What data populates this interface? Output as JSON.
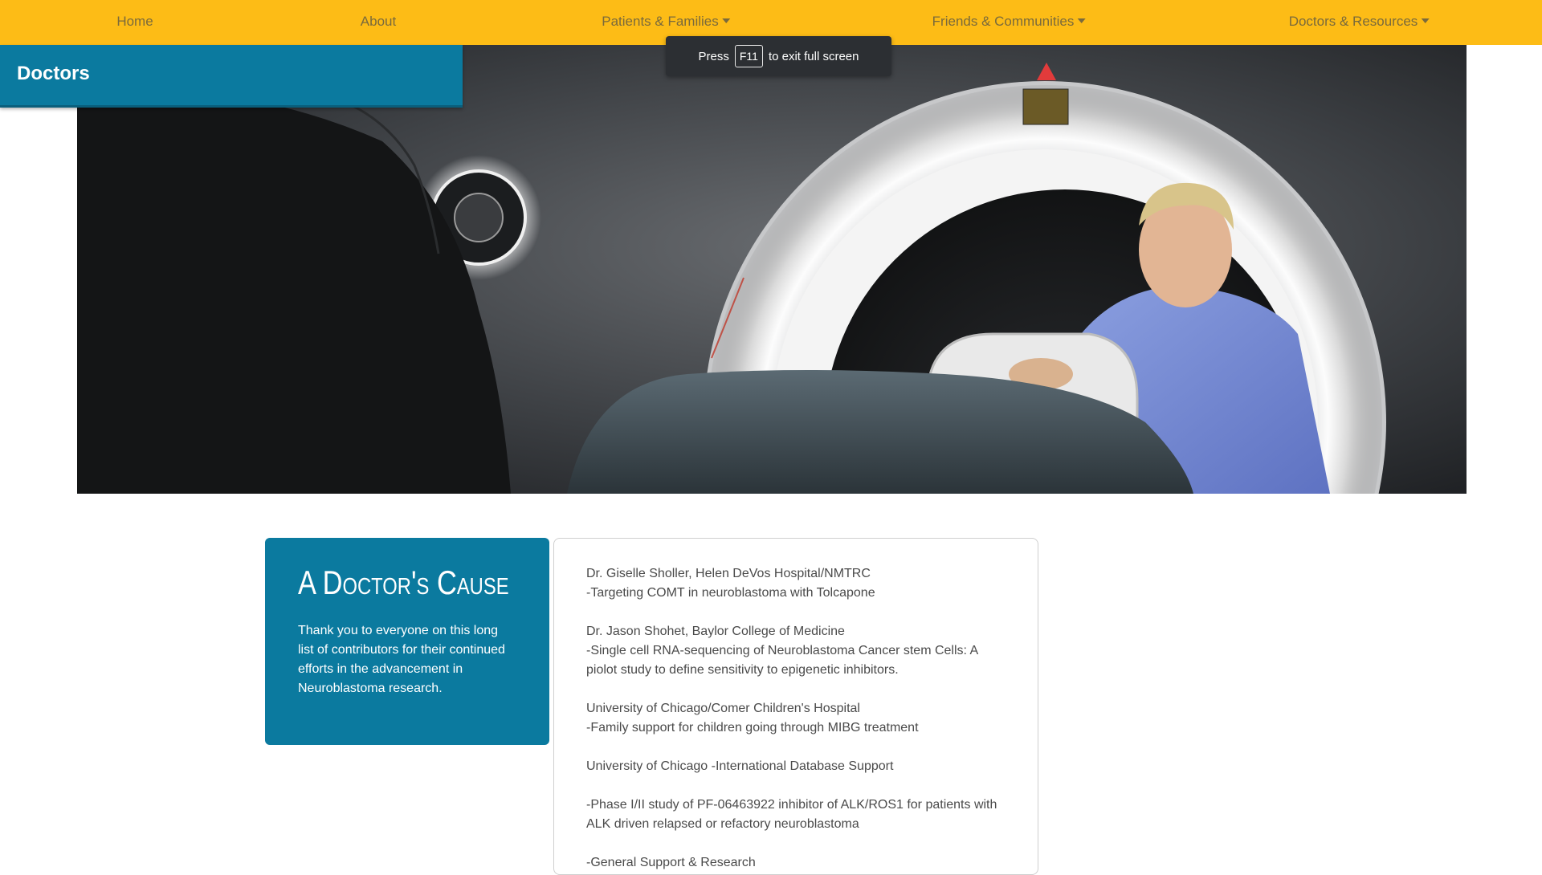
{
  "nav": {
    "items": [
      {
        "label": "Home",
        "dropdown": false
      },
      {
        "label": "About",
        "dropdown": false
      },
      {
        "label": "Patients & Families",
        "dropdown": true
      },
      {
        "label": "Friends & Communities",
        "dropdown": true
      },
      {
        "label": "Doctors & Resources",
        "dropdown": true
      }
    ]
  },
  "fullscreen_toast": {
    "press": "Press",
    "key": "F11",
    "message": "to exit full screen"
  },
  "page": {
    "title": "Doctors"
  },
  "hero": {
    "image_description_icon": "mri-scanner-photo"
  },
  "cause_card": {
    "heading": "A Doctor's Cause",
    "body": "Thank you to everyone on this long list of contributors for their continued efforts in the advancement in Neuroblastoma research."
  },
  "contributors": [
    {
      "lines": [
        "Dr. Giselle Sholler, Helen DeVos Hospital/NMTRC",
        "-Targeting COMT in neuroblastoma with Tolcapone"
      ]
    },
    {
      "lines": [
        "Dr. Jason Shohet, Baylor College of Medicine",
        "-Single cell RNA-sequencing of Neuroblastoma Cancer stem Cells: A piolot study to define sensitivity to epigenetic inhibitors."
      ]
    },
    {
      "lines": [
        "University of Chicago/Comer Children's Hospital",
        "-Family support for children going through MIBG treatment"
      ]
    },
    {
      "lines": [
        "University of Chicago -International Database Support"
      ]
    },
    {
      "lines": [
        "-Phase I/II study of PF-06463922 inhibitor of ALK/ROS1 for patients with ALK driven relapsed or refactory neuroblastoma"
      ]
    },
    {
      "lines": [
        "-General Support & Research"
      ]
    }
  ],
  "colors": {
    "nav_bg": "#fdbc16",
    "brand_teal": "#0b7a9f",
    "text_gray": "#4a4a4a"
  }
}
